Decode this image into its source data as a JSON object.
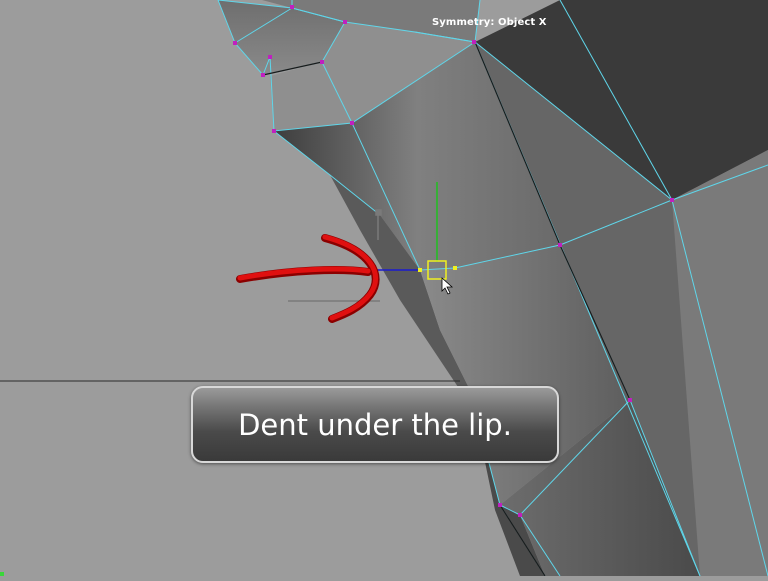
{
  "viewport": {
    "symmetry_label": "Symmetry: Object X"
  },
  "caption": {
    "text": "Dent under the lip."
  },
  "colors": {
    "background": "#9c9c9c",
    "wireframe": "#5fd6ea",
    "vertex": "#c020c0",
    "annotation_arrow": "#e01010",
    "manipulator_x": "#1a1ad0",
    "manipulator_y": "#20c020",
    "selection": "#f0f020"
  },
  "icons": {
    "cursor": "mouse-pointer-icon",
    "annotation": "red-arrow-annotation"
  }
}
